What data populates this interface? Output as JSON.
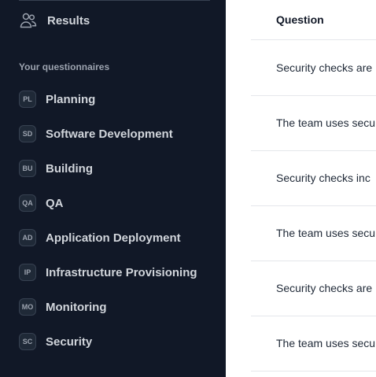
{
  "sidebar": {
    "results_label": "Results",
    "section_heading": "Your questionnaires",
    "items": [
      {
        "badge": "PL",
        "label": "Planning"
      },
      {
        "badge": "SD",
        "label": "Software Development"
      },
      {
        "badge": "BU",
        "label": "Building"
      },
      {
        "badge": "QA",
        "label": "QA"
      },
      {
        "badge": "AD",
        "label": "Application Deployment"
      },
      {
        "badge": "IP",
        "label": "Infrastructure Provisioning"
      },
      {
        "badge": "MO",
        "label": "Monitoring"
      },
      {
        "badge": "SC",
        "label": "Security"
      }
    ]
  },
  "table": {
    "header": "Question",
    "rows": [
      "Security checks are",
      "The team uses secu",
      "Security checks inc",
      "The team uses secu",
      "Security checks are",
      "The team uses secu"
    ]
  },
  "icons": {
    "results": "users-icon"
  },
  "colors": {
    "sidebar_bg": "#111827",
    "main_bg": "#ffffff"
  }
}
